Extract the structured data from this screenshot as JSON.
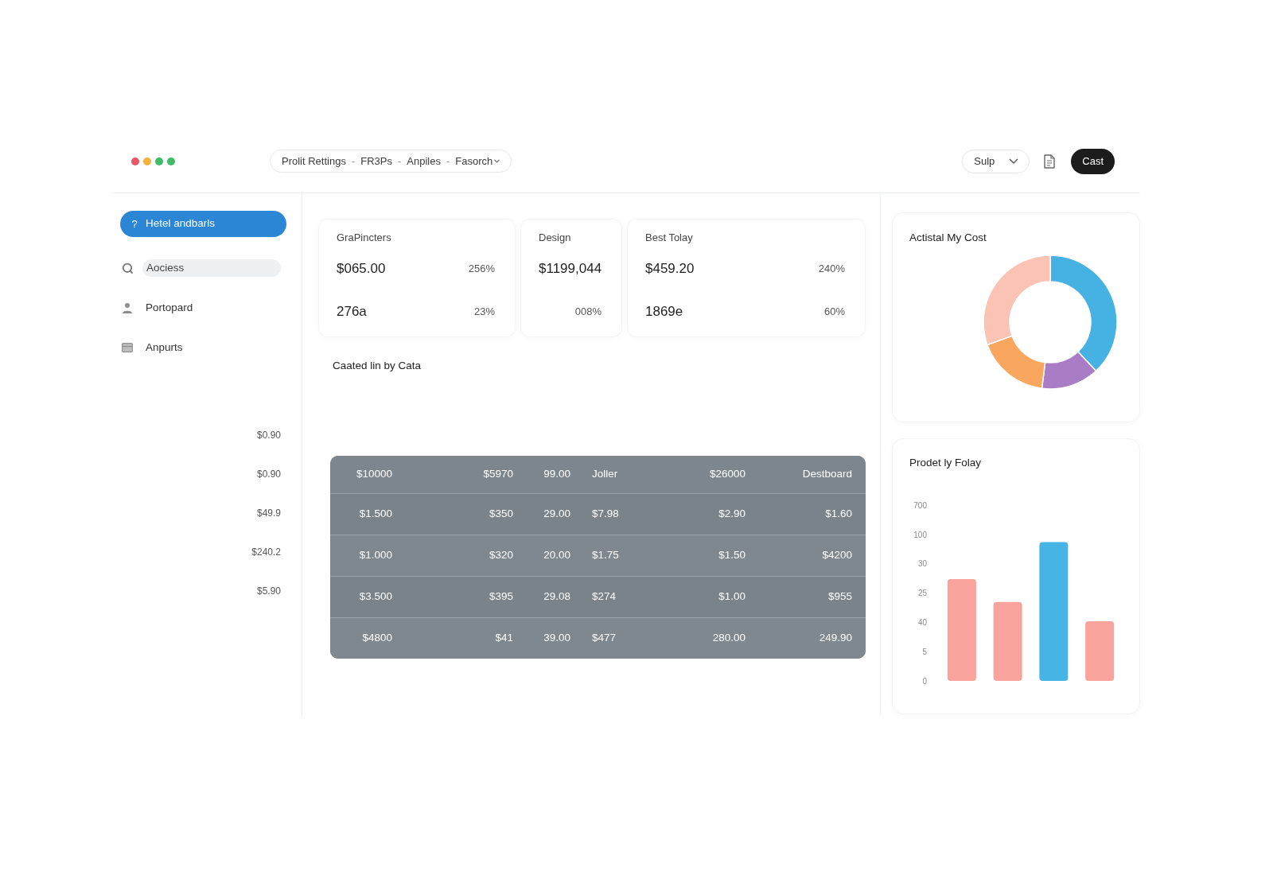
{
  "header": {
    "breadcrumb": {
      "items": [
        "Prolit Rettings",
        "FR3Ps",
        "Anpiles",
        "Fasorch"
      ],
      "separator": "-"
    },
    "dropdown": {
      "label": "Sulp"
    },
    "button": {
      "label": "Cast"
    }
  },
  "sidebar": {
    "items": [
      {
        "kind": "button",
        "glyph": "?",
        "label": "Hetel andbarls",
        "selected": true
      },
      {
        "kind": "search",
        "label": "Aociess",
        "selected": false
      },
      {
        "kind": "link",
        "label": "Portopard",
        "selected": false
      },
      {
        "kind": "link",
        "label": "Anpurts",
        "selected": false
      }
    ],
    "amounts": [
      "$0.90",
      "$0.90",
      "$49.9",
      "$240.2",
      "$5.90"
    ]
  },
  "stat_cards": [
    {
      "label": "GraPincters",
      "rows": [
        {
          "value": "$065.00",
          "change": "256%"
        },
        {
          "value": "276a",
          "change": "23%"
        }
      ]
    },
    {
      "label": "Design",
      "rows": [
        {
          "value": "$1199,044"
        },
        {
          "change": "008%"
        }
      ]
    },
    {
      "label": "Best Tolay",
      "rows": [
        {
          "value": "$459.20",
          "change": "240%"
        },
        {
          "value": "1869e",
          "change": "60%"
        }
      ]
    }
  ],
  "section_title": "Caated lin by Cata",
  "table": {
    "columns": [
      "$10000",
      "$5970",
      "99.00",
      "Joller",
      "$26000",
      "Destboard"
    ],
    "rows": [
      [
        "$1.500",
        "$350",
        "29.00",
        "$7.98",
        "$2.90",
        "$1.60"
      ],
      [
        "$1.000",
        "$320",
        "20.00",
        "$1.75",
        "$1.50",
        "$4200"
      ],
      [
        "$3.500",
        "$395",
        "29.08",
        "$274",
        "$1.00",
        "$955"
      ],
      [
        "$4800",
        "$41",
        "39.00",
        "$477",
        "280.00",
        "249.90"
      ]
    ]
  },
  "cost_card": {
    "title": "Actistal My Cost"
  },
  "bar_card": {
    "title": "Prodet ly Folay",
    "axis_labels": [
      "700",
      "100",
      "30",
      "25",
      "40",
      "5",
      "0"
    ]
  }
}
